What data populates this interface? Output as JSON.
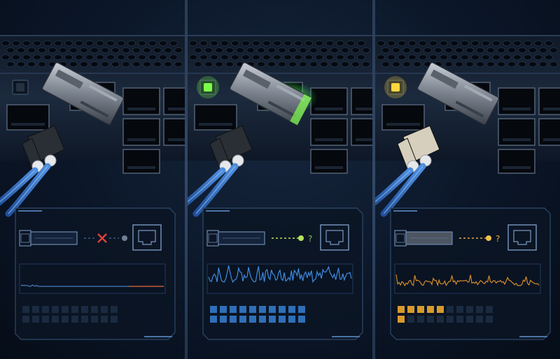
{
  "panels": [
    {
      "id": "panel-1",
      "state": "no-link",
      "port_led": "off",
      "module_glow": false,
      "connector_color": "#2a2e35",
      "link_symbol": "x",
      "link_symbol_color": "#e0413a",
      "link_dot_color": "#6f7f95",
      "waveform": "flat",
      "waveform_color": "#4a7fc0",
      "accent_color": "#3a5a85",
      "active_cells": 0,
      "cell_active_color": "#2e4a6e",
      "cell_idle_color": "#1a2a40"
    },
    {
      "id": "panel-2",
      "state": "link-active",
      "port_led": "green",
      "module_glow": true,
      "connector_color": "#2a2e35",
      "link_symbol": "?",
      "link_symbol_color": "#7fbf4a",
      "link_dot_color": "#b7e35a",
      "waveform": "active",
      "waveform_color": "#3f8be0",
      "accent_color": "#b7e35a",
      "active_cells": 20,
      "cell_active_color": "#2f6fb8",
      "cell_idle_color": "#1a2a40"
    },
    {
      "id": "panel-3",
      "state": "link-uncertain",
      "port_led": "yellow",
      "module_glow": false,
      "connector_color": "#d7cfbd",
      "link_symbol": "?",
      "link_symbol_color": "#e2a93a",
      "link_dot_color": "#f1c24a",
      "waveform": "noisy",
      "waveform_color": "#d08a2a",
      "accent_color": "#e2a93a",
      "active_cells": 6,
      "cell_active_color": "#d89a2c",
      "cell_idle_color": "#1a2a40"
    }
  ]
}
